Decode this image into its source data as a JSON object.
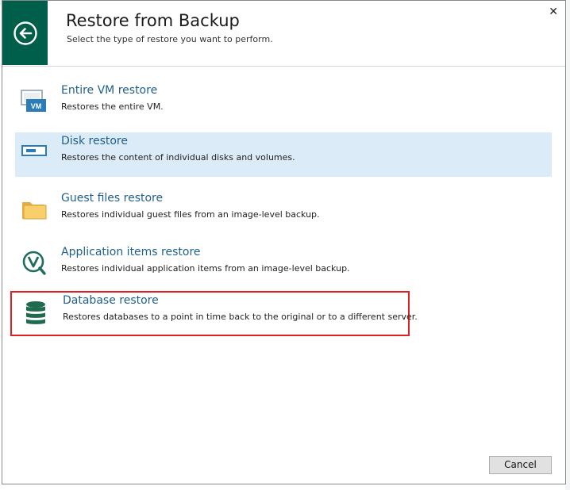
{
  "dialog": {
    "title": "Restore from Backup",
    "subtitle": "Select the type of restore you want to perform.",
    "close_glyph": "✕"
  },
  "options": [
    {
      "name": "Entire VM restore",
      "desc": "Restores the entire VM.",
      "icon": "vm-icon"
    },
    {
      "name": "Disk restore",
      "desc": "Restores the content of individual disks and volumes.",
      "icon": "disk-icon",
      "selected": true
    },
    {
      "name": "Guest files restore",
      "desc": "Restores individual guest files from an image-level backup.",
      "icon": "folder-icon"
    },
    {
      "name": "Application items restore",
      "desc": "Restores individual application items from an image-level backup.",
      "icon": "veeam-explorer-icon"
    },
    {
      "name": "Database restore",
      "desc": "Restores databases to a point in time back to the original or to a different server.",
      "icon": "database-icon",
      "highlighted": true
    }
  ],
  "buttons": {
    "cancel_label": "Cancel"
  },
  "colors": {
    "header_accent": "#005f4b",
    "link_blue": "#1f5f8b",
    "selected_bg": "#dcebf8",
    "highlight_border": "#e02020"
  }
}
